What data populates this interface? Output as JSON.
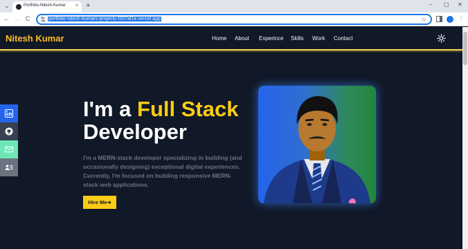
{
  "browser": {
    "tab_title": "Portfolio-Nitesh-Kumar",
    "tab_close": "×",
    "new_tab": "+",
    "url": "portfolio-nitesh-kumars-projects-f207af1e.vercel.app",
    "min_glyph": "–",
    "max_glyph": "▢",
    "close_glyph": "✕",
    "back": "←",
    "forward": "→",
    "reload": "C",
    "star": "☆",
    "menu": "⋮",
    "tab_menu": "⌄"
  },
  "navbar": {
    "brand": "Nitesh Kumar",
    "links": [
      "Home",
      "About",
      "Experince",
      "Skills",
      "Work",
      "Contact"
    ],
    "accent": "#fbbf24"
  },
  "social": [
    {
      "name": "linkedin",
      "icon": "linkedin-icon",
      "color": "#2563eb"
    },
    {
      "name": "github",
      "icon": "github-icon",
      "color": "#374151"
    },
    {
      "name": "email",
      "icon": "mail-icon",
      "color": "#6ee7b7"
    },
    {
      "name": "resume",
      "icon": "contact-card-icon",
      "color": "#6b7280"
    }
  ],
  "hero": {
    "heading_pre": "I'm a ",
    "heading_highlight": "Full Stack",
    "heading_post": "Developer",
    "description": "I'm a MERN-stack developer specializing in building (and occasionally designing) exceptional digital experiences. Currently, I'm focused on building responsive MERN-stack web applications.",
    "cta_label": "Hire Me",
    "cta_arrow": "➔"
  }
}
